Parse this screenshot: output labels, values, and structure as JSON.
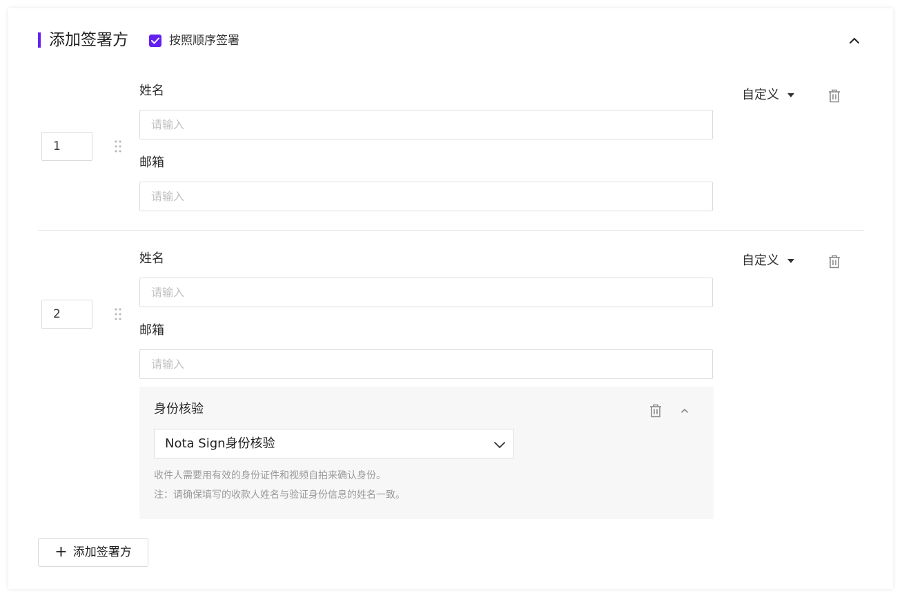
{
  "header": {
    "title": "添加签署方",
    "sign_in_order_label": "按照顺序签署",
    "sign_in_order_checked": true,
    "accent_color": "#6320ee"
  },
  "signers": [
    {
      "order": "1",
      "name_label": "姓名",
      "name_placeholder": "请输入",
      "email_label": "邮箱",
      "email_placeholder": "请输入",
      "role": "自定义"
    },
    {
      "order": "2",
      "name_label": "姓名",
      "name_placeholder": "请输入",
      "email_label": "邮箱",
      "email_placeholder": "请输入",
      "role": "自定义",
      "identity_verification": {
        "title": "身份核验",
        "method": "Nota Sign身份核验",
        "description": "收件人需要用有效的身份证件和视频自拍来确认身份。",
        "note": "注：请确保填写的收款人姓名与验证身份信息的姓名一致。"
      }
    }
  ],
  "add_signer_button": {
    "icon": "+",
    "label": "添加签署方"
  }
}
